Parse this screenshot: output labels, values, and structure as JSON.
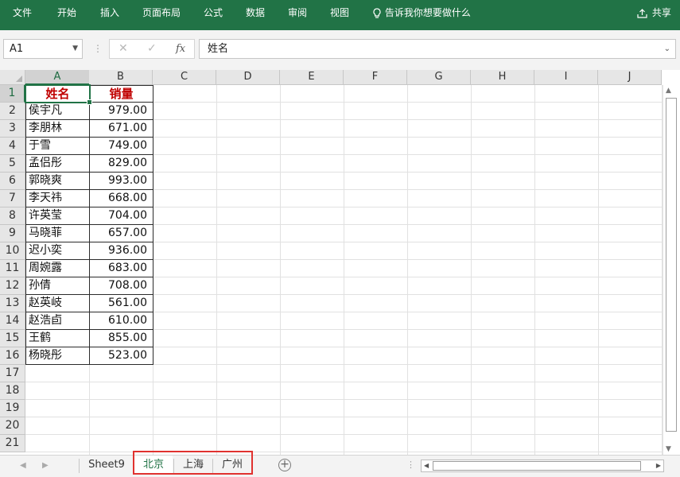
{
  "ribbon": {
    "tabs": [
      "文件",
      "开始",
      "插入",
      "页面布局",
      "公式",
      "数据",
      "审阅",
      "视图"
    ],
    "tell_me": "告诉我你想要做什么",
    "share": "共享",
    "color": "#217346"
  },
  "formula_bar": {
    "name_box": "A1",
    "formula": "姓名",
    "fx": "fx",
    "cancel_glyph": "✕",
    "enter_glyph": "✓"
  },
  "columns": [
    "A",
    "B",
    "C",
    "D",
    "E",
    "F",
    "G",
    "H",
    "I",
    "J"
  ],
  "rows": [
    "1",
    "2",
    "3",
    "4",
    "5",
    "6",
    "7",
    "8",
    "9",
    "10",
    "11",
    "12",
    "13",
    "14",
    "15",
    "16",
    "17",
    "18",
    "19",
    "20",
    "21"
  ],
  "table": {
    "headers": [
      "姓名",
      "销量"
    ],
    "header_color": "#c00000",
    "rows": [
      [
        "侯宇凡",
        "979.00"
      ],
      [
        "李朋林",
        "671.00"
      ],
      [
        "于雪",
        "749.00"
      ],
      [
        "孟侣彤",
        "829.00"
      ],
      [
        "郭晓爽",
        "993.00"
      ],
      [
        "李天祎",
        "668.00"
      ],
      [
        "许英莹",
        "704.00"
      ],
      [
        "马晓菲",
        "657.00"
      ],
      [
        "迟小奕",
        "936.00"
      ],
      [
        "周婉露",
        "683.00"
      ],
      [
        "孙倩",
        "708.00"
      ],
      [
        "赵英岐",
        "561.00"
      ],
      [
        "赵浩卣",
        "610.00"
      ],
      [
        "王鹤",
        "855.00"
      ],
      [
        "杨晓彤",
        "523.00"
      ]
    ]
  },
  "sheet_tabs": [
    "Sheet9",
    "北京",
    "上海",
    "广州"
  ],
  "active_sheet": "北京",
  "highlight_color": "#e0322f"
}
